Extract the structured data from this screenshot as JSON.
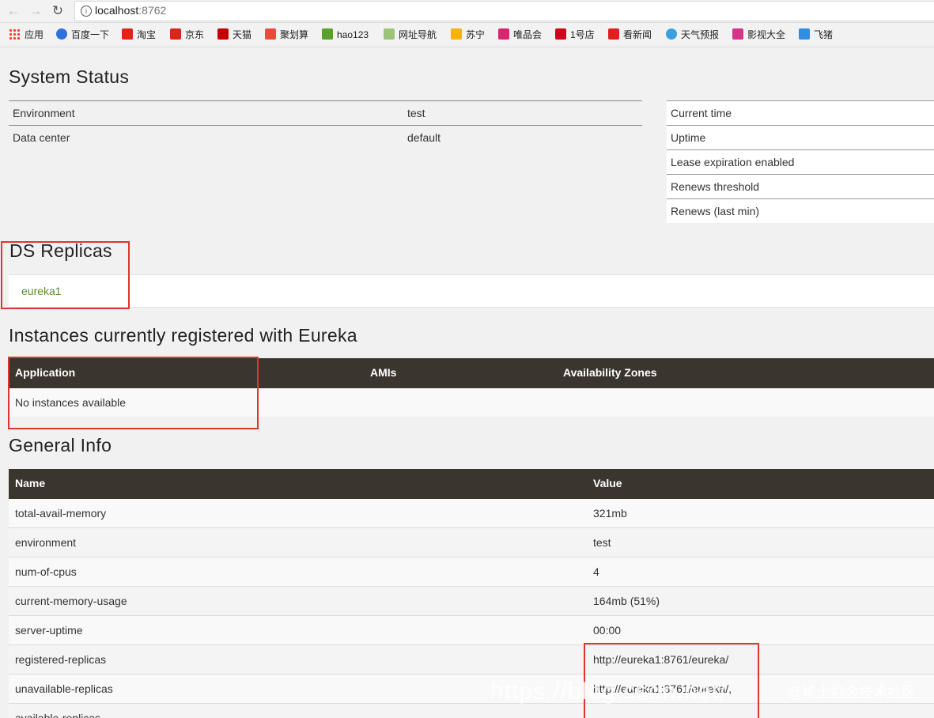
{
  "browser": {
    "url_host": "localhost",
    "url_port": ":8762",
    "back_icon": "arrow-left-icon",
    "forward_icon": "arrow-right-icon",
    "reload_icon": "reload-icon"
  },
  "bookmarks": [
    {
      "label": "应用",
      "color": "#e94235"
    },
    {
      "label": "百度一下",
      "color": "#2f6fde"
    },
    {
      "label": "淘宝",
      "color": "#e1251b"
    },
    {
      "label": "京东",
      "color": "#d7261b"
    },
    {
      "label": "天猫",
      "color": "#c40000"
    },
    {
      "label": "聚划算",
      "color": "#e84c3d"
    },
    {
      "label": "hao123",
      "color": "#5aa02c"
    },
    {
      "label": "网址导航",
      "color": "#9bc47a"
    },
    {
      "label": "苏宁",
      "color": "#f4b400"
    },
    {
      "label": "唯品会",
      "color": "#d6266f"
    },
    {
      "label": "1号店",
      "color": "#d0021b"
    },
    {
      "label": "看新闻",
      "color": "#e02020"
    },
    {
      "label": "天气预报",
      "color": "#3aa0e0"
    },
    {
      "label": "影视大全",
      "color": "#d6338a"
    },
    {
      "label": "飞猪",
      "color": "#2f8de4"
    }
  ],
  "system_status": {
    "title": "System Status",
    "left_rows": [
      {
        "label": "Environment",
        "value": "test"
      },
      {
        "label": "Data center",
        "value": "default"
      }
    ],
    "right_rows": [
      {
        "label": "Current time"
      },
      {
        "label": "Uptime"
      },
      {
        "label": "Lease expiration enabled"
      },
      {
        "label": "Renews threshold"
      },
      {
        "label": "Renews (last min)"
      }
    ]
  },
  "ds_replicas": {
    "title": "DS Replicas",
    "items": [
      "eureka1"
    ]
  },
  "instances": {
    "title": "Instances currently registered with Eureka",
    "columns": [
      "Application",
      "AMIs",
      "Availability Zones"
    ],
    "empty_text": "No instances available"
  },
  "general_info": {
    "title": "General Info",
    "columns": [
      "Name",
      "Value"
    ],
    "rows": [
      {
        "name": "total-avail-memory",
        "value": "321mb"
      },
      {
        "name": "environment",
        "value": "test"
      },
      {
        "name": "num-of-cpus",
        "value": "4"
      },
      {
        "name": "current-memory-usage",
        "value": "164mb (51%)"
      },
      {
        "name": "server-uptime",
        "value": "00:00"
      },
      {
        "name": "registered-replicas",
        "value": "http://eureka1:8761/eureka/"
      },
      {
        "name": "unavailable-replicas",
        "value": "http://eureka1:8761/eureka/,"
      },
      {
        "name": "available-replicas",
        "value": ""
      }
    ]
  },
  "watermark": {
    "url_text": "https://blog.csdn.net/",
    "site_text": "@稀土掘金技术社区"
  },
  "colors": {
    "table_header": "#3a362e",
    "link_green": "#5b8c2e",
    "annotation_red": "#e0342f"
  }
}
